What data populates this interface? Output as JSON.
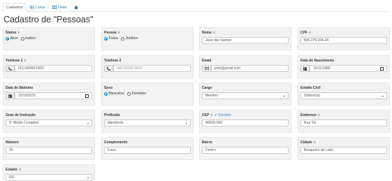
{
  "tabs": [
    {
      "label": "Cadastrar",
      "icon": ""
    },
    {
      "label": "Listar",
      "icon": "grid-icon"
    },
    {
      "label": "Listar",
      "icon": "plus-square-icon"
    },
    {
      "label": "",
      "icon": "home-icon"
    }
  ],
  "page_title": "Cadastro de \"Pessoas\"",
  "fields": {
    "status": {
      "label": "Status",
      "options": [
        "Ativo",
        "Inativo"
      ],
      "selected": "Ativo"
    },
    "pessoa": {
      "label": "Pessoa",
      "options": [
        "Física",
        "Jurídica"
      ],
      "selected": "Física"
    },
    "nome": {
      "label": "Nome",
      "value": "José dos Santos"
    },
    "cpf": {
      "label": "CPF",
      "value": "825.279.104-24"
    },
    "telefone1": {
      "label": "Telefone 1",
      "value": "(51) 99999-5555"
    },
    "telefone2": {
      "label": "Telefone 2",
      "placeholder": "(00) 00000-0000"
    },
    "email": {
      "label": "Email",
      "value": "jose@gmail.com"
    },
    "data_nascimento": {
      "label": "Data de Nascimento",
      "value": "10/11/1980"
    },
    "data_batismo": {
      "label": "Data de Batismo",
      "value": "15/10/2015"
    },
    "sexo": {
      "label": "Sexo",
      "options": [
        "Masculino",
        "Feminino"
      ],
      "selected": "Masculino"
    },
    "cargo": {
      "label": "Cargo",
      "value": "Membro"
    },
    "estado_civil": {
      "label": "Estado Civil",
      "value": "Solteiro(a)"
    },
    "grau_instrucao": {
      "label": "Grau de Instrução",
      "value": "5° Médio Completo"
    },
    "profissao": {
      "label": "Profissão",
      "value": "Atendente"
    },
    "cep": {
      "label": "CEP",
      "link": "Correios",
      "value": "90920-000"
    },
    "endereco": {
      "label": "Endereço",
      "value": "Rua Tal"
    },
    "numero": {
      "label": "Número",
      "value": "20"
    },
    "complemento": {
      "label": "Complemento",
      "value": "Casa"
    },
    "bairro": {
      "label": "Bairro",
      "value": "Centro"
    },
    "cidade": {
      "label": "Cidade",
      "value": "Bosqueiro do Leão"
    },
    "estado": {
      "label": "Estado",
      "value": "RS"
    }
  },
  "colors": {
    "link": "#337ab7",
    "card_bg": "#f2f2f2",
    "radio_accent": "#1a73e8"
  }
}
